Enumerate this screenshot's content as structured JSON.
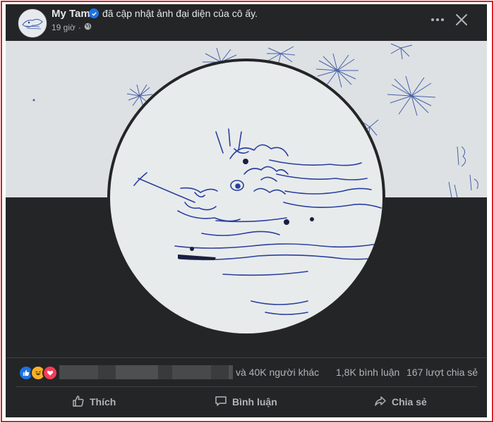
{
  "post": {
    "author": "My Tam",
    "action": "đã cập nhật ảnh đại diện của cô ấy.",
    "time": "19 giờ",
    "privacy_icon": "globe-icon"
  },
  "stats": {
    "others": "và 40K người khác",
    "comments": "1,8K bình luận",
    "shares": "167 lượt chia sẻ"
  },
  "actions": {
    "like": "Thích",
    "comment": "Bình luận",
    "share": "Chia sẻ"
  },
  "colors": {
    "background": "#242526",
    "accent": "#1b74e4",
    "border": "#d71f26",
    "love": "#f33e58",
    "haha": "#f7b125"
  }
}
